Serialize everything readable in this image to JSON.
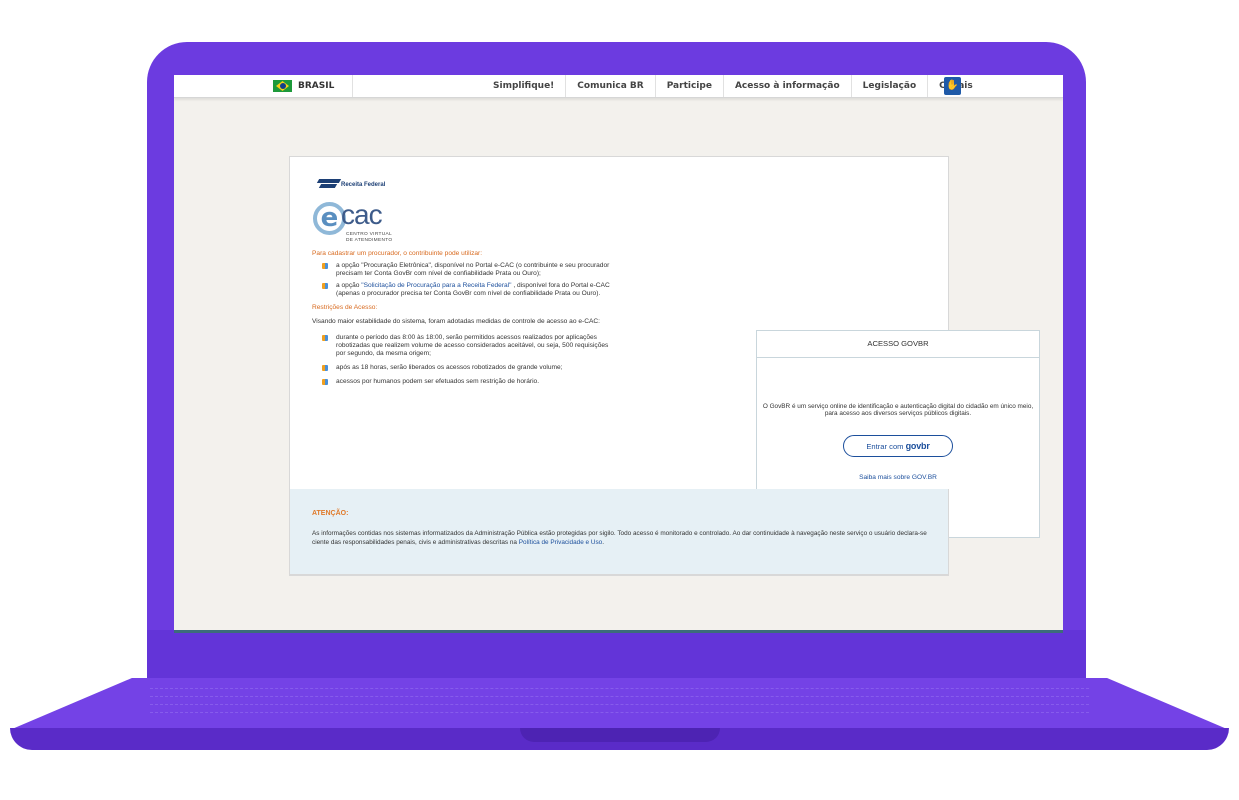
{
  "topbar": {
    "country": "BRASIL",
    "nav": [
      "Simplifique!",
      "Comunica BR",
      "Participe",
      "Acesso à informação",
      "Legislação",
      "Canais"
    ]
  },
  "logo": {
    "agency": "Receita Federal",
    "product": "cac",
    "product_prefix": "e",
    "subtitle_line1": "CENTRO VIRTUAL",
    "subtitle_line2": "DE ATENDIMENTO"
  },
  "procurador": {
    "heading": "Para cadastrar um procurador, o contribuinte pode utilizar:",
    "item1": "a opção \"Procuração Eletrônica\", disponível no Portal e-CAC (o contribuinte e seu procurador precisam ter Conta GovBr com nível de confiabilidade Prata ou Ouro);",
    "item2_pre": "a opção ",
    "item2_link": "\"Solicitação de Procuração para a Receita Federal\"",
    "item2_post": " , disponível fora do Portal e-CAC (apenas o procurador precisa ter Conta GovBr com nível de confiabilidade Prata ou Ouro)."
  },
  "restricoes": {
    "heading": "Restrições de Acesso:",
    "intro": "Visando maior estabilidade do sistema, foram adotadas medidas de controle de acesso ao e-CAC:",
    "items": [
      "durante o período das 8:00 às 18:00, serão permitidos acessos realizados por aplicações robotizadas que realizem volume de acesso considerados aceitável, ou seja, 500 requisições por segundo, da mesma origem;",
      "após as 18 horas, serão liberados os acessos robotizados de grande volume;",
      "acessos por humanos podem ser efetuados sem restrição de horário."
    ]
  },
  "govbr": {
    "title": "ACESSO GOVBR",
    "description": "O GovBR é um serviço online de identificação e autenticação digital do cidadão em único meio, para acesso aos diversos serviços públicos digitais.",
    "button_prefix": "Entrar com",
    "button_brand": "govbr",
    "more_link": "Saiba mais sobre GOV.BR"
  },
  "atencao": {
    "title": "ATENÇÃO:",
    "text": "As informações contidas nos sistemas informatizados da Administração Pública estão protegidas por sigilo. Todo acesso é monitorado e controlado. Ao dar continuidade à navegação neste serviço o usuário declara-se ciente das responsabilidades penais, civis e administrativas descritas na ",
    "link": "Política de Privacidade e Uso",
    "suffix": "."
  },
  "colors": {
    "laptop": "#6c3be0",
    "accent_orange": "#d86a1f",
    "link_blue": "#1c4f9c"
  },
  "icons": [
    "brazil-flag-icon",
    "receita-federal-logo",
    "vlibras-icon",
    "bullet-icon"
  ]
}
